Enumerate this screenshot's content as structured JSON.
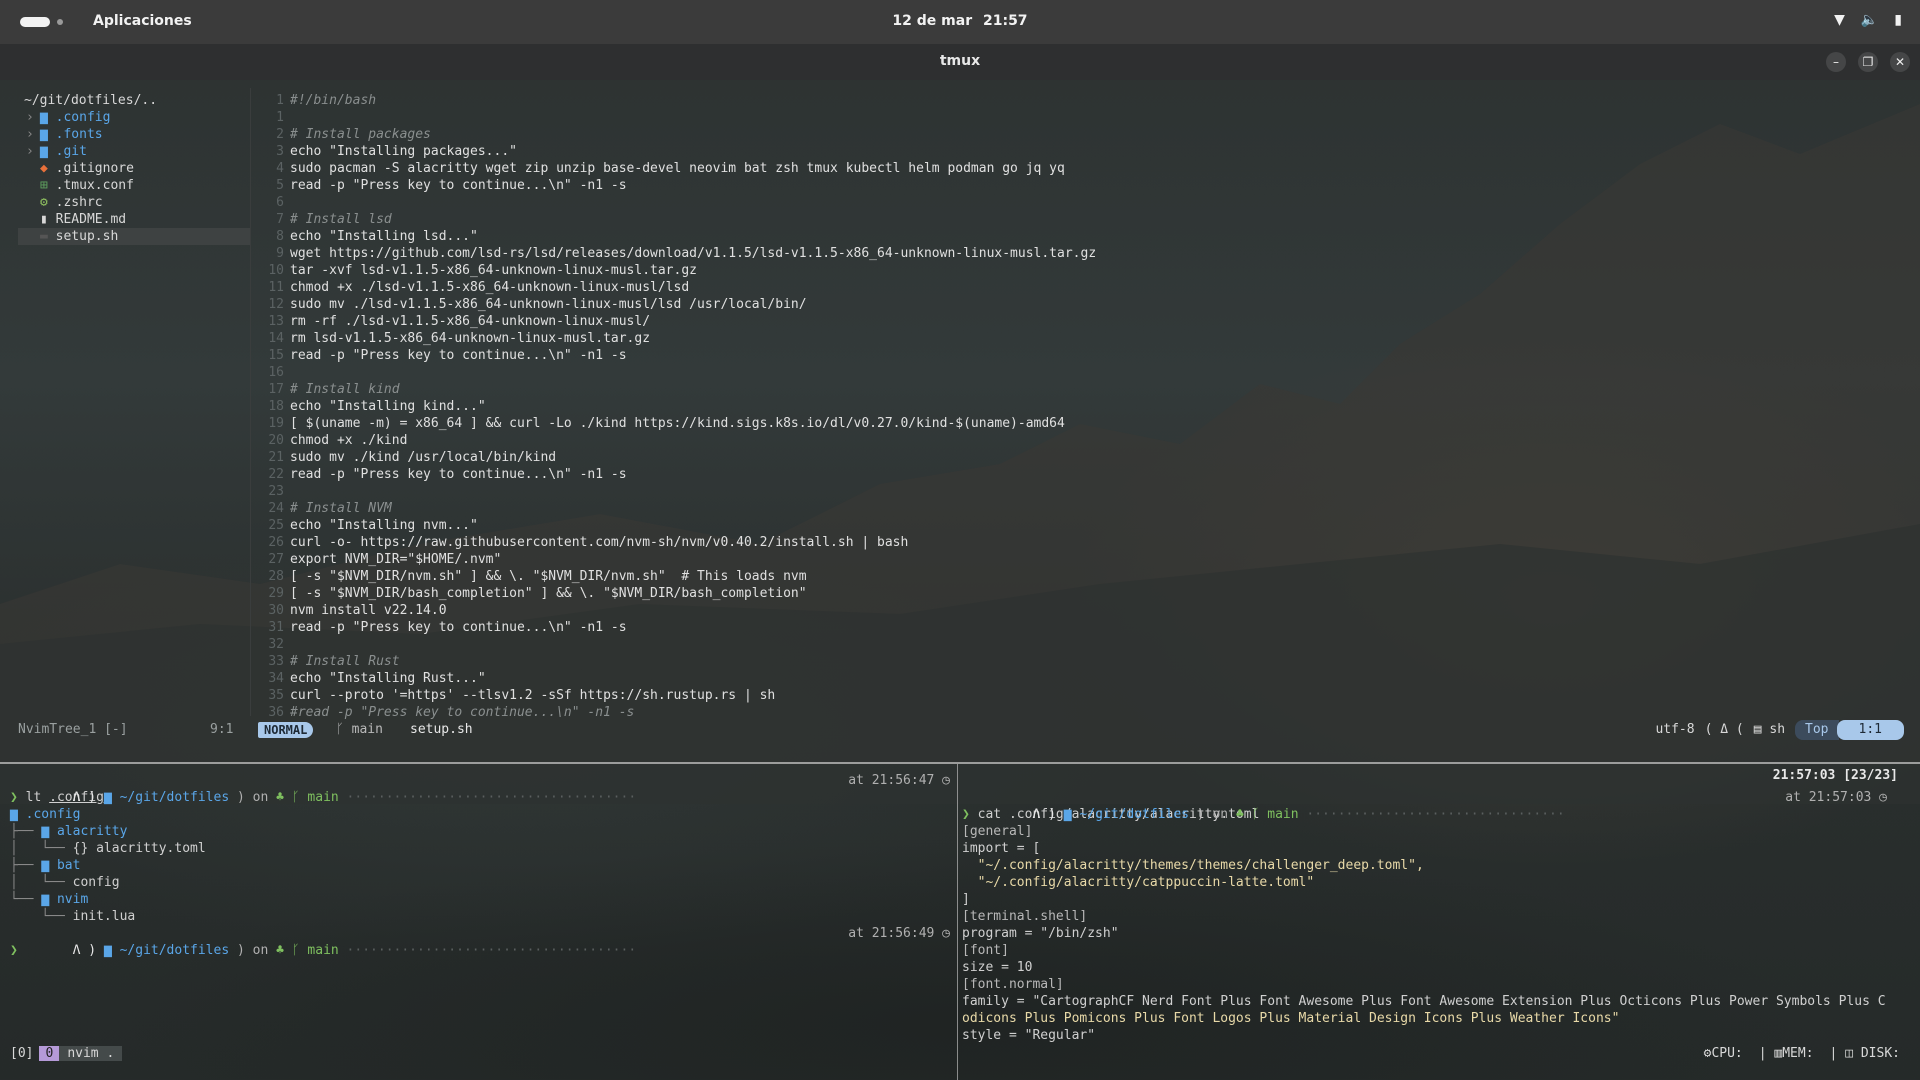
{
  "topbar": {
    "activities": "Aplicaciones",
    "date": "12 de mar",
    "time": "21:57"
  },
  "window": {
    "title": "tmux",
    "minimize": "–",
    "maximize": "❐",
    "close": "✕"
  },
  "tree": {
    "root": "~/git/dotfiles/..",
    "items": [
      {
        "chevron": "›",
        "icon": "▆",
        "name": ".config"
      },
      {
        "chevron": "›",
        "icon": "▆",
        "name": ".fonts"
      },
      {
        "chevron": "›",
        "icon": "▆",
        "name": ".git"
      },
      {
        "chevron": "",
        "icon": "◆",
        "name": ".gitignore"
      },
      {
        "chevron": "",
        "icon": "⊞",
        "name": ".tmux.conf"
      },
      {
        "chevron": "",
        "icon": "⚙",
        "name": ".zshrc"
      },
      {
        "chevron": "",
        "icon": "▮",
        "name": "README.md"
      },
      {
        "chevron": "",
        "icon": "▬",
        "name": "setup.sh"
      }
    ]
  },
  "editor": {
    "lines": [
      {
        "n": "1",
        "t": "#!/bin/bash",
        "c": "cm"
      },
      {
        "n": "1",
        "t": "",
        "c": ""
      },
      {
        "n": "2",
        "t": "# Install packages",
        "c": "cm"
      },
      {
        "n": "3",
        "t": "echo \"Installing packages...\"",
        "c": "kw"
      },
      {
        "n": "4",
        "t": "sudo pacman -S alacritty wget zip unzip base-devel neovim bat zsh tmux kubectl helm podman go jq yq",
        "c": "kw"
      },
      {
        "n": "5",
        "t": "read -p \"Press key to continue...\\n\" -n1 -s",
        "c": "kw"
      },
      {
        "n": "6",
        "t": "",
        "c": ""
      },
      {
        "n": "7",
        "t": "# Install lsd",
        "c": "cm"
      },
      {
        "n": "8",
        "t": "echo \"Installing lsd...\"",
        "c": "kw"
      },
      {
        "n": "9",
        "t": "wget https://github.com/lsd-rs/lsd/releases/download/v1.1.5/lsd-v1.1.5-x86_64-unknown-linux-musl.tar.gz",
        "c": "kw"
      },
      {
        "n": "10",
        "t": "tar -xvf lsd-v1.1.5-x86_64-unknown-linux-musl.tar.gz",
        "c": "kw"
      },
      {
        "n": "11",
        "t": "chmod +x ./lsd-v1.1.5-x86_64-unknown-linux-musl/lsd",
        "c": "kw"
      },
      {
        "n": "12",
        "t": "sudo mv ./lsd-v1.1.5-x86_64-unknown-linux-musl/lsd /usr/local/bin/",
        "c": "kw"
      },
      {
        "n": "13",
        "t": "rm -rf ./lsd-v1.1.5-x86_64-unknown-linux-musl/",
        "c": "kw"
      },
      {
        "n": "14",
        "t": "rm lsd-v1.1.5-x86_64-unknown-linux-musl.tar.gz",
        "c": "kw"
      },
      {
        "n": "15",
        "t": "read -p \"Press key to continue...\\n\" -n1 -s",
        "c": "kw"
      },
      {
        "n": "16",
        "t": "",
        "c": ""
      },
      {
        "n": "17",
        "t": "# Install kind",
        "c": "cm"
      },
      {
        "n": "18",
        "t": "echo \"Installing kind...\"",
        "c": "kw"
      },
      {
        "n": "19",
        "t": "[ $(uname -m) = x86_64 ] && curl -Lo ./kind https://kind.sigs.k8s.io/dl/v0.27.0/kind-$(uname)-amd64",
        "c": "kw"
      },
      {
        "n": "20",
        "t": "chmod +x ./kind",
        "c": "kw"
      },
      {
        "n": "21",
        "t": "sudo mv ./kind /usr/local/bin/kind",
        "c": "kw"
      },
      {
        "n": "22",
        "t": "read -p \"Press key to continue...\\n\" -n1 -s",
        "c": "kw"
      },
      {
        "n": "23",
        "t": "",
        "c": ""
      },
      {
        "n": "24",
        "t": "# Install NVM",
        "c": "cm"
      },
      {
        "n": "25",
        "t": "echo \"Installing nvm...\"",
        "c": "kw"
      },
      {
        "n": "26",
        "t": "curl -o- https://raw.githubusercontent.com/nvm-sh/nvm/v0.40.2/install.sh | bash",
        "c": "kw"
      },
      {
        "n": "27",
        "t": "export NVM_DIR=\"$HOME/.nvm\"",
        "c": "kw"
      },
      {
        "n": "28",
        "t": "[ -s \"$NVM_DIR/nvm.sh\" ] && \\. \"$NVM_DIR/nvm.sh\"  # This loads nvm",
        "c": "kw"
      },
      {
        "n": "29",
        "t": "[ -s \"$NVM_DIR/bash_completion\" ] && \\. \"$NVM_DIR/bash_completion\"",
        "c": "kw"
      },
      {
        "n": "30",
        "t": "nvm install v22.14.0",
        "c": "kw"
      },
      {
        "n": "31",
        "t": "read -p \"Press key to continue...\\n\" -n1 -s",
        "c": "kw"
      },
      {
        "n": "32",
        "t": "",
        "c": ""
      },
      {
        "n": "33",
        "t": "# Install Rust",
        "c": "cm"
      },
      {
        "n": "34",
        "t": "echo \"Installing Rust...\"",
        "c": "kw"
      },
      {
        "n": "35",
        "t": "curl --proto '=https' --tlsv1.2 -sSf https://sh.rustup.rs | sh",
        "c": "kw"
      },
      {
        "n": "36",
        "t": "#read -p \"Press key to continue...\\n\" -n1 -s",
        "c": "cm"
      }
    ]
  },
  "statusline": {
    "tree_name": "NvimTree_1 [-]",
    "tree_pos": "9:1",
    "mode": "NORMAL",
    "branch": "main",
    "file": "setup.sh",
    "encoding": "utf-8",
    "filetype": "sh",
    "scroll": "Top",
    "position": "1:1"
  },
  "left_pane": {
    "prompt1": {
      "dir": "~/git/dotfiles",
      "on": "on",
      "branch": "main",
      "time": "at 21:56:47"
    },
    "cmd1_prefix": "lt ",
    "cmd1_arg": ".config",
    "tree": [
      {
        "prefix": "",
        "name": ".config",
        "dir": true
      },
      {
        "prefix": "├── ",
        "name": "alacritty",
        "dir": true
      },
      {
        "prefix": "│   └── ",
        "name": "{} alacritty.toml",
        "dir": false
      },
      {
        "prefix": "├── ",
        "name": "bat",
        "dir": true
      },
      {
        "prefix": "│   └── ",
        "name": "config",
        "dir": false
      },
      {
        "prefix": "└── ",
        "name": "nvim",
        "dir": true
      },
      {
        "prefix": "    └── ",
        "name": "init.lua",
        "dir": false
      }
    ],
    "prompt2": {
      "dir": "~/git/dotfiles",
      "on": "on",
      "branch": "main",
      "time": "at 21:56:49"
    }
  },
  "right_pane": {
    "clock": "21:57:03 [23/23]",
    "prompt": {
      "dir": "~/git/dotfiles",
      "on": "on",
      "branch": "main",
      "time": "at 21:57:03"
    },
    "cmd": "cat .config/alacritty/alacritty.toml",
    "lines": [
      {
        "t": "[general]",
        "c": "toml-sec"
      },
      {
        "t": "import = [",
        "c": "toml-key"
      },
      {
        "t": "  \"~/.config/alacritty/themes/themes/challenger_deep.toml\",",
        "c": "toml-str"
      },
      {
        "t": "  \"~/.config/alacritty/catppuccin-latte.toml\"",
        "c": "toml-str"
      },
      {
        "t": "]",
        "c": "toml-key"
      },
      {
        "t": "[terminal.shell]",
        "c": "toml-sec"
      },
      {
        "t": "program = \"/bin/zsh\"",
        "c": "toml-key"
      },
      {
        "t": "[font]",
        "c": "toml-sec"
      },
      {
        "t": "size = 10",
        "c": "toml-key"
      },
      {
        "t": "[font.normal]",
        "c": "toml-sec"
      },
      {
        "t": "family = \"CartographCF Nerd Font Plus Font Awesome Plus Font Awesome Extension Plus Octicons Plus Power Symbols Plus C",
        "c": "toml-key"
      },
      {
        "t": "odicons Plus Pomicons Plus Font Logos Plus Material Design Icons Plus Weather Icons\"",
        "c": "toml-str"
      },
      {
        "t": "style = \"Regular\"",
        "c": "toml-key"
      }
    ]
  },
  "tmux": {
    "session": "[0]",
    "window_index": "0",
    "window_name": "nvim .",
    "cpu": "CPU:",
    "mem": "MEM:",
    "disk": "DISK:"
  }
}
